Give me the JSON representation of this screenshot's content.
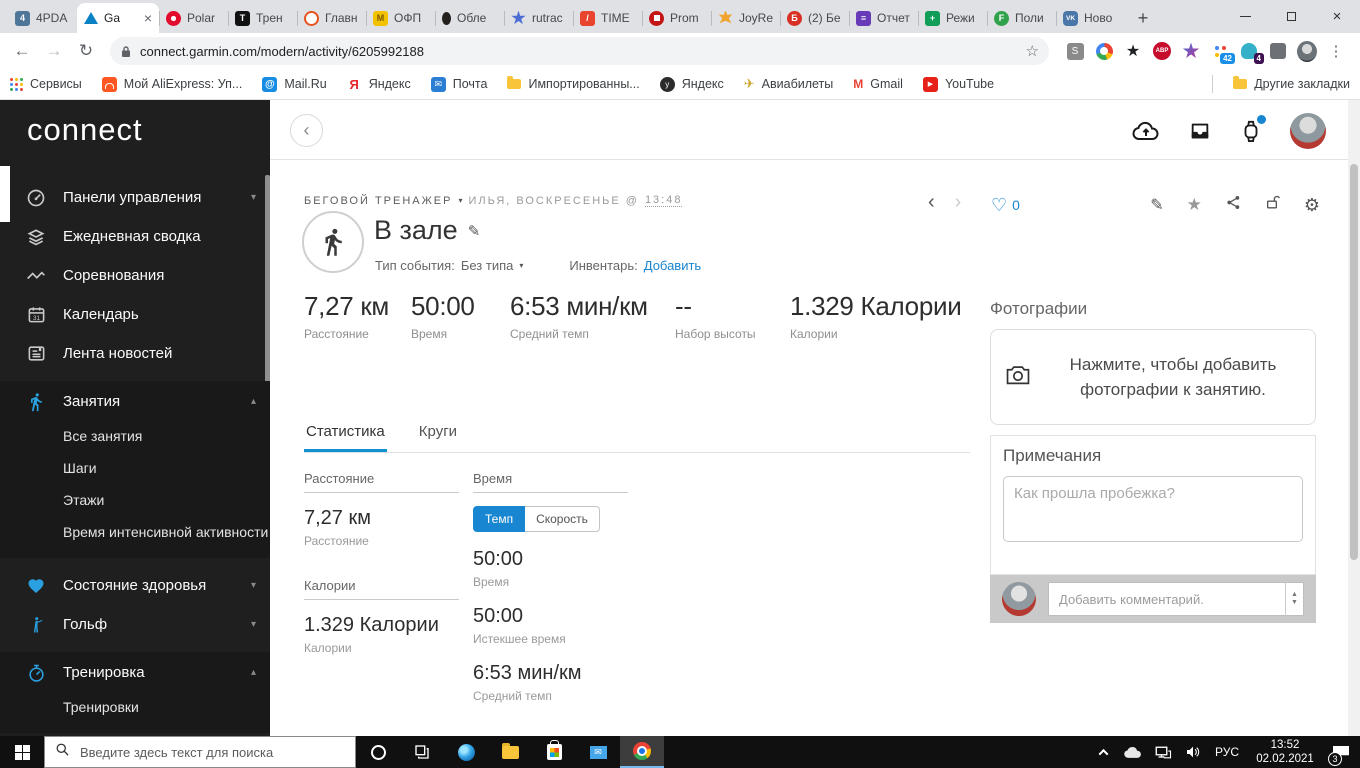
{
  "icons": {
    "close": "×",
    "plus": "+",
    "back": "←",
    "forward": "→",
    "reload": "↻",
    "chevron_down": "▾",
    "chevron_up": "▴",
    "chevron_left": "‹",
    "chevron_right": "›",
    "heart_outline": "♡",
    "star": "★",
    "star_outline": "☆",
    "pencil": "✎",
    "gear": "⚙",
    "menu_dots": "⋮",
    "spin_up": "▲",
    "spin_down": "▼",
    "fav": {
      "pda": "4",
      "t": "T",
      "m": "M",
      "slash": "/",
      "b": "Б",
      "list": "≡",
      "plus": "+",
      "f": "F",
      "vk": "VK"
    },
    "bm": {
      "at": "@",
      "ya": "Я",
      "mail": "✉",
      "plane": "✈",
      "gmail": "M",
      "play": "▶",
      "globe": "y"
    }
  },
  "colors": {
    "accent_blue": "#1886d0",
    "tab_underline": "#1191cf",
    "sidebar_bg": "#1f1f1f"
  },
  "browser": {
    "tabs": [
      "4PDA",
      "Ga",
      "Polar",
      "Трен",
      "Главн",
      "ОФП",
      "Обле",
      "rutrac",
      "TIME",
      "Prom",
      "JoyRe",
      "(2) Бе",
      "Отчет",
      "Режи",
      "Поли",
      "Ново"
    ],
    "url": "connect.garmin.com/modern/activity/6205992188",
    "ext": {
      "s": "S",
      "abp": "ABP",
      "badge_blue": "42",
      "badge_ghost": "4"
    },
    "bookmarks": [
      "Сервисы",
      "Мой AliExpress: Уп...",
      "Mail.Ru",
      "Яндекс",
      "Почта",
      "Импортированны...",
      "Яндекс",
      "Авиабилеты",
      "Gmail",
      "YouTube"
    ],
    "other_bookmarks": "Другие закладки"
  },
  "sidebar": {
    "logo": "connect",
    "items": [
      "Панели управления",
      "Ежедневная сводка",
      "Соревнования",
      "Календарь",
      "Лента новостей",
      "Занятия",
      "Состояние здоровья",
      "Гольф",
      "Тренировка"
    ],
    "activities_children": [
      "Все занятия",
      "Шаги",
      "Этажи",
      "Время интенсивной активности"
    ],
    "training_children": [
      "Тренировки"
    ]
  },
  "activity": {
    "sport": "БЕГОВОЙ ТРЕНАЖЕР",
    "owner": "ИЛЬЯ, ВОСКРЕСЕНЬЕ @",
    "time": "13:48",
    "likes": "0",
    "title": "В зале",
    "event_type_label": "Тип события:",
    "event_type_value": "Без типа",
    "inventory_label": "Инвентарь:",
    "inventory_add": "Добавить",
    "summary": [
      {
        "value": "7,27 км",
        "label": "Расстояние"
      },
      {
        "value": "50:00",
        "label": "Время"
      },
      {
        "value": "6:53 мин/км",
        "label": "Средний темп"
      },
      {
        "value": "--",
        "label": "Набор высоты"
      },
      {
        "value": "1.329 Калории",
        "label": "Калории"
      }
    ],
    "tabs": [
      "Статистика",
      "Круги"
    ],
    "distance_section": {
      "header": "Расстояние",
      "value": "7,27 км",
      "label": "Расстояние"
    },
    "calories_section": {
      "header": "Калории",
      "value": "1.329 Калории",
      "label": "Калории"
    },
    "time_section": {
      "header": "Время",
      "toggle": [
        "Темп",
        "Скорость"
      ],
      "rows": [
        {
          "value": "50:00",
          "label": "Время"
        },
        {
          "value": "50:00",
          "label": "Истекшее время"
        },
        {
          "value": "6:53 мин/км",
          "label": "Средний темп"
        }
      ]
    }
  },
  "right_panel": {
    "photos_title": "Фотографии",
    "photos_hint": "Нажмите, чтобы добавить фотографии к занятию.",
    "notes_title": "Примечания",
    "notes_placeholder": "Как прошла пробежка?",
    "comment_placeholder": "Добавить комментарий."
  },
  "taskbar": {
    "search_placeholder": "Введите здесь текст для поиска",
    "lang": "РУС",
    "time": "13:52",
    "date": "02.02.2021",
    "badge": "3"
  }
}
